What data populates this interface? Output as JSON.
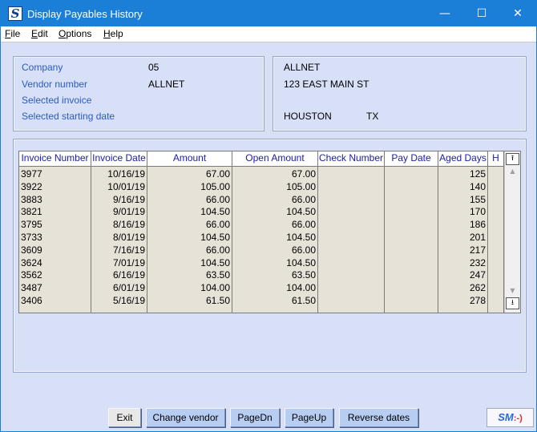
{
  "window": {
    "title": "Display Payables History",
    "icon_letter": "S",
    "minimize": "—",
    "maximize": "☐",
    "close": "✕"
  },
  "menu": [
    {
      "label": "File",
      "accel": "F",
      "rest": "ile"
    },
    {
      "label": "Edit",
      "accel": "E",
      "rest": "dit"
    },
    {
      "label": "Options",
      "accel": "O",
      "rest": "ptions"
    },
    {
      "label": "Help",
      "accel": "H",
      "rest": "elp"
    }
  ],
  "info": {
    "company_label": "Company",
    "company_value": "05",
    "vendor_label": "Vendor number",
    "vendor_value": "ALLNET",
    "invoice_label": "Selected invoice",
    "invoice_value": "",
    "start_date_label": "Selected starting date",
    "start_date_value": ""
  },
  "vendor": {
    "name": "ALLNET",
    "address": "123 EAST MAIN ST",
    "city": "HOUSTON",
    "state": "TX"
  },
  "table": {
    "columns": [
      "Invoice Number",
      "Invoice Date",
      "Amount",
      "Open Amount",
      "Check Number",
      "Pay Date",
      "Aged Days",
      "H"
    ],
    "rows": [
      [
        "3977",
        "10/16/19",
        "67.00",
        "67.00",
        "",
        "",
        "125",
        ""
      ],
      [
        "3922",
        "10/01/19",
        "105.00",
        "105.00",
        "",
        "",
        "140",
        ""
      ],
      [
        "3883",
        "9/16/19",
        "66.00",
        "66.00",
        "",
        "",
        "155",
        ""
      ],
      [
        "3821",
        "9/01/19",
        "104.50",
        "104.50",
        "",
        "",
        "170",
        ""
      ],
      [
        "3795",
        "8/16/19",
        "66.00",
        "66.00",
        "",
        "",
        "186",
        ""
      ],
      [
        "3733",
        "8/01/19",
        "104.50",
        "104.50",
        "",
        "",
        "201",
        ""
      ],
      [
        "3609",
        "7/16/19",
        "66.00",
        "66.00",
        "",
        "",
        "217",
        ""
      ],
      [
        "3624",
        "7/01/19",
        "104.50",
        "104.50",
        "",
        "",
        "232",
        ""
      ],
      [
        "3562",
        "6/16/19",
        "63.50",
        "63.50",
        "",
        "",
        "247",
        ""
      ],
      [
        "3487",
        "6/01/19",
        "104.00",
        "104.00",
        "",
        "",
        "262",
        ""
      ],
      [
        "3406",
        "5/16/19",
        "61.50",
        "61.50",
        "",
        "",
        "278",
        ""
      ]
    ]
  },
  "scrollbar": {
    "top_icon": "scroll-to-top-icon",
    "bottom_icon": "scroll-to-bottom-icon",
    "up_glyph": "▲",
    "down_glyph": "▼",
    "top_glyph": "⭱",
    "bottom_glyph": "⭳"
  },
  "buttons": {
    "exit": "Exit",
    "change_vendor": "Change vendor",
    "page_dn": "PageDn",
    "page_up": "PageUp",
    "reverse_dates": "Reverse dates"
  },
  "logo": {
    "text": "SM",
    "smile": ":-)"
  },
  "colors": {
    "titlebar": "#1b7fd8",
    "window_bg": "#d8e0f8",
    "label_blue": "#2a5bc4",
    "header_text": "#1a1ab0",
    "grid_bg": "#e6e2d8",
    "button_bg": "#b8cdf2"
  }
}
